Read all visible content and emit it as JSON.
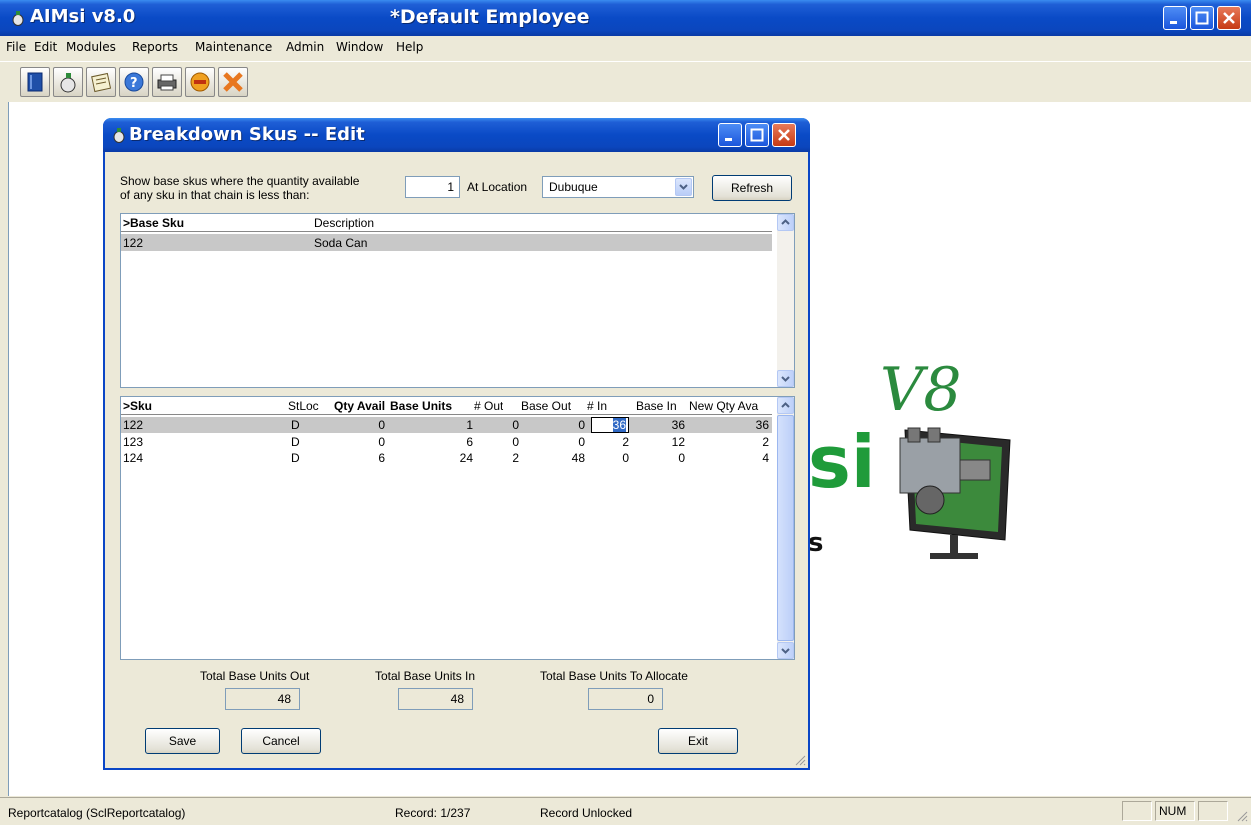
{
  "window": {
    "app_title": "AIMsi v8.0",
    "doc_title": "*Default Employee"
  },
  "menu": [
    "File",
    "Edit",
    "Modules",
    "Reports",
    "Maintenance",
    "Admin",
    "Window",
    "Help"
  ],
  "toolbar": {
    "icons": [
      "book-icon",
      "money-bag-icon",
      "notepad-icon",
      "help-icon",
      "printer-icon",
      "stop-icon",
      "exit-icon"
    ]
  },
  "logo": {
    "v8": "V8",
    "si": "si",
    "s": "s"
  },
  "dialog": {
    "title": "Breakdown Skus -- Edit",
    "prompt_line1": "Show base skus where the quantity available",
    "prompt_line2": "of any sku in that chain is less than:",
    "quantity_value": "1",
    "location_label": "At Location",
    "location_value": "Dubuque",
    "refresh_label": "Refresh",
    "base_grid": {
      "columns": [
        ">Base Sku",
        "Description"
      ],
      "rows": [
        {
          "base_sku": "122",
          "description": "Soda Can"
        }
      ]
    },
    "sku_grid": {
      "columns": [
        ">Sku",
        "StLoc",
        "Qty Avail",
        "Base Units",
        "# Out",
        "Base Out",
        "# In",
        "Base In",
        "New Qty Ava"
      ],
      "rows": [
        {
          "sku": "122",
          "stloc": "D",
          "qty_avail": "0",
          "base_units": "1",
          "out": "0",
          "base_out": "0",
          "in": "36",
          "base_in": "36",
          "new_qty": "36"
        },
        {
          "sku": "123",
          "stloc": "D",
          "qty_avail": "0",
          "base_units": "6",
          "out": "0",
          "base_out": "0",
          "in": "2",
          "base_in": "12",
          "new_qty": "2"
        },
        {
          "sku": "124",
          "stloc": "D",
          "qty_avail": "6",
          "base_units": "24",
          "out": "2",
          "base_out": "48",
          "in": "0",
          "base_in": "0",
          "new_qty": "4"
        }
      ]
    },
    "totals": {
      "out_label": "Total Base Units Out",
      "out_value": "48",
      "in_label": "Total Base Units In",
      "in_value": "48",
      "allocate_label": "Total Base Units To Allocate",
      "allocate_value": "0"
    },
    "buttons": {
      "save": "Save",
      "cancel": "Cancel",
      "exit": "Exit"
    }
  },
  "statusbar": {
    "report": "Reportcatalog (SclReportcatalog)",
    "record": "Record: 1/237",
    "lock": "Record Unlocked",
    "num": "NUM"
  }
}
